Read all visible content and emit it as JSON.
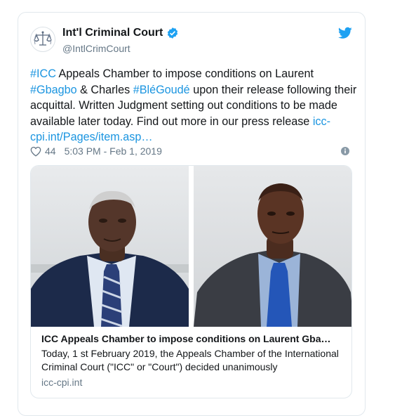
{
  "account": {
    "name": "Int'l Criminal Court",
    "handle": "@IntlCrimCourt"
  },
  "tweet": {
    "segments": [
      {
        "text": "#ICC",
        "type": "hashtag"
      },
      {
        "text": " Appeals Chamber to impose conditions on Laurent ",
        "type": "plain"
      },
      {
        "text": "#Gbagbo",
        "type": "hashtag"
      },
      {
        "text": " & Charles ",
        "type": "plain"
      },
      {
        "text": "#BléGoudé",
        "type": "hashtag"
      },
      {
        "text": " upon their release following their acquittal. Written Judgment setting out conditions to be made available later today. Find out more in our press release ",
        "type": "plain"
      },
      {
        "text": "icc-cpi.int/Pages/item.asp…",
        "type": "link"
      }
    ],
    "likes": "44",
    "timestamp": "5:03 PM - Feb 1, 2019"
  },
  "card": {
    "title": "ICC Appeals Chamber to impose conditions on Laurent Gba…",
    "description": "Today, 1 st February 2019, the Appeals Chamber of the International Criminal Court (\"ICC\" or \"Court\") decided unanimously",
    "domain": "icc-cpi.int"
  },
  "icons": {
    "avatar": "icc-scales-logo-icon",
    "verified": "verified-badge-icon",
    "brand": "twitter-bird-icon",
    "like": "heart-icon",
    "info": "info-icon"
  },
  "colors": {
    "link": "#1b95e0",
    "verified": "#1da1f2",
    "muted": "#657786"
  }
}
